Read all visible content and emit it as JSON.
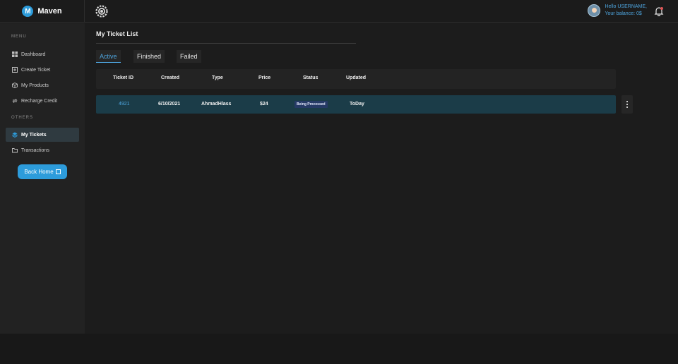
{
  "brand": {
    "initial": "M",
    "name": "Maven"
  },
  "user": {
    "greeting": "Hello USERNAME,",
    "balance": "Your balance: 0$"
  },
  "sidebar": {
    "menu_title": "MENU",
    "others_title": "OTHERS",
    "items": [
      {
        "label": "Dashboard",
        "icon": "dashboard-icon"
      },
      {
        "label": "Create Ticket",
        "icon": "plus-square-icon"
      },
      {
        "label": "My Products",
        "icon": "box-icon"
      },
      {
        "label": "Recharge Credit",
        "icon": "refresh-icon"
      },
      {
        "label": "My Tickets",
        "icon": "layers-icon",
        "active": true
      },
      {
        "label": "Transactions",
        "icon": "folder-icon"
      }
    ],
    "back_home": "Back Home"
  },
  "main": {
    "title": "My Ticket List",
    "tabs": [
      {
        "label": "Active",
        "active": true
      },
      {
        "label": "Finished"
      },
      {
        "label": "Failed"
      }
    ],
    "table": {
      "columns": [
        "Ticket ID",
        "Created",
        "Type",
        "Price",
        "Status",
        "Updated"
      ],
      "rows": [
        {
          "id": "4921",
          "created": "6/10/2021",
          "type": "AhmadHlass",
          "price": "$24",
          "status": "Being Processed",
          "updated": "ToDay"
        }
      ]
    }
  },
  "colors": {
    "accent": "#2d9cdb",
    "row_bg": "#1b3c48",
    "badge_bg": "#263a66"
  }
}
